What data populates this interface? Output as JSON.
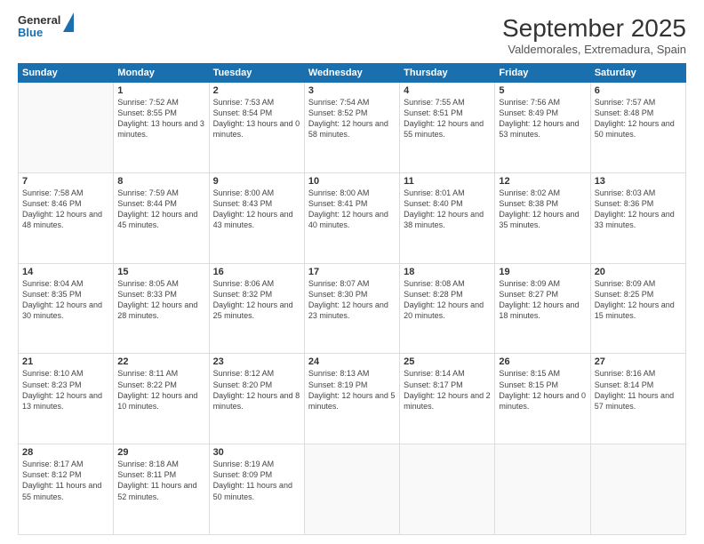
{
  "logo": {
    "line1": "General",
    "line2": "Blue"
  },
  "title": "September 2025",
  "subtitle": "Valdemorales, Extremadura, Spain",
  "days_of_week": [
    "Sunday",
    "Monday",
    "Tuesday",
    "Wednesday",
    "Thursday",
    "Friday",
    "Saturday"
  ],
  "weeks": [
    [
      {
        "day": "",
        "sunrise": "",
        "sunset": "",
        "daylight": ""
      },
      {
        "day": "1",
        "sunrise": "Sunrise: 7:52 AM",
        "sunset": "Sunset: 8:55 PM",
        "daylight": "Daylight: 13 hours and 3 minutes."
      },
      {
        "day": "2",
        "sunrise": "Sunrise: 7:53 AM",
        "sunset": "Sunset: 8:54 PM",
        "daylight": "Daylight: 13 hours and 0 minutes."
      },
      {
        "day": "3",
        "sunrise": "Sunrise: 7:54 AM",
        "sunset": "Sunset: 8:52 PM",
        "daylight": "Daylight: 12 hours and 58 minutes."
      },
      {
        "day": "4",
        "sunrise": "Sunrise: 7:55 AM",
        "sunset": "Sunset: 8:51 PM",
        "daylight": "Daylight: 12 hours and 55 minutes."
      },
      {
        "day": "5",
        "sunrise": "Sunrise: 7:56 AM",
        "sunset": "Sunset: 8:49 PM",
        "daylight": "Daylight: 12 hours and 53 minutes."
      },
      {
        "day": "6",
        "sunrise": "Sunrise: 7:57 AM",
        "sunset": "Sunset: 8:48 PM",
        "daylight": "Daylight: 12 hours and 50 minutes."
      }
    ],
    [
      {
        "day": "7",
        "sunrise": "Sunrise: 7:58 AM",
        "sunset": "Sunset: 8:46 PM",
        "daylight": "Daylight: 12 hours and 48 minutes."
      },
      {
        "day": "8",
        "sunrise": "Sunrise: 7:59 AM",
        "sunset": "Sunset: 8:44 PM",
        "daylight": "Daylight: 12 hours and 45 minutes."
      },
      {
        "day": "9",
        "sunrise": "Sunrise: 8:00 AM",
        "sunset": "Sunset: 8:43 PM",
        "daylight": "Daylight: 12 hours and 43 minutes."
      },
      {
        "day": "10",
        "sunrise": "Sunrise: 8:00 AM",
        "sunset": "Sunset: 8:41 PM",
        "daylight": "Daylight: 12 hours and 40 minutes."
      },
      {
        "day": "11",
        "sunrise": "Sunrise: 8:01 AM",
        "sunset": "Sunset: 8:40 PM",
        "daylight": "Daylight: 12 hours and 38 minutes."
      },
      {
        "day": "12",
        "sunrise": "Sunrise: 8:02 AM",
        "sunset": "Sunset: 8:38 PM",
        "daylight": "Daylight: 12 hours and 35 minutes."
      },
      {
        "day": "13",
        "sunrise": "Sunrise: 8:03 AM",
        "sunset": "Sunset: 8:36 PM",
        "daylight": "Daylight: 12 hours and 33 minutes."
      }
    ],
    [
      {
        "day": "14",
        "sunrise": "Sunrise: 8:04 AM",
        "sunset": "Sunset: 8:35 PM",
        "daylight": "Daylight: 12 hours and 30 minutes."
      },
      {
        "day": "15",
        "sunrise": "Sunrise: 8:05 AM",
        "sunset": "Sunset: 8:33 PM",
        "daylight": "Daylight: 12 hours and 28 minutes."
      },
      {
        "day": "16",
        "sunrise": "Sunrise: 8:06 AM",
        "sunset": "Sunset: 8:32 PM",
        "daylight": "Daylight: 12 hours and 25 minutes."
      },
      {
        "day": "17",
        "sunrise": "Sunrise: 8:07 AM",
        "sunset": "Sunset: 8:30 PM",
        "daylight": "Daylight: 12 hours and 23 minutes."
      },
      {
        "day": "18",
        "sunrise": "Sunrise: 8:08 AM",
        "sunset": "Sunset: 8:28 PM",
        "daylight": "Daylight: 12 hours and 20 minutes."
      },
      {
        "day": "19",
        "sunrise": "Sunrise: 8:09 AM",
        "sunset": "Sunset: 8:27 PM",
        "daylight": "Daylight: 12 hours and 18 minutes."
      },
      {
        "day": "20",
        "sunrise": "Sunrise: 8:09 AM",
        "sunset": "Sunset: 8:25 PM",
        "daylight": "Daylight: 12 hours and 15 minutes."
      }
    ],
    [
      {
        "day": "21",
        "sunrise": "Sunrise: 8:10 AM",
        "sunset": "Sunset: 8:23 PM",
        "daylight": "Daylight: 12 hours and 13 minutes."
      },
      {
        "day": "22",
        "sunrise": "Sunrise: 8:11 AM",
        "sunset": "Sunset: 8:22 PM",
        "daylight": "Daylight: 12 hours and 10 minutes."
      },
      {
        "day": "23",
        "sunrise": "Sunrise: 8:12 AM",
        "sunset": "Sunset: 8:20 PM",
        "daylight": "Daylight: 12 hours and 8 minutes."
      },
      {
        "day": "24",
        "sunrise": "Sunrise: 8:13 AM",
        "sunset": "Sunset: 8:19 PM",
        "daylight": "Daylight: 12 hours and 5 minutes."
      },
      {
        "day": "25",
        "sunrise": "Sunrise: 8:14 AM",
        "sunset": "Sunset: 8:17 PM",
        "daylight": "Daylight: 12 hours and 2 minutes."
      },
      {
        "day": "26",
        "sunrise": "Sunrise: 8:15 AM",
        "sunset": "Sunset: 8:15 PM",
        "daylight": "Daylight: 12 hours and 0 minutes."
      },
      {
        "day": "27",
        "sunrise": "Sunrise: 8:16 AM",
        "sunset": "Sunset: 8:14 PM",
        "daylight": "Daylight: 11 hours and 57 minutes."
      }
    ],
    [
      {
        "day": "28",
        "sunrise": "Sunrise: 8:17 AM",
        "sunset": "Sunset: 8:12 PM",
        "daylight": "Daylight: 11 hours and 55 minutes."
      },
      {
        "day": "29",
        "sunrise": "Sunrise: 8:18 AM",
        "sunset": "Sunset: 8:11 PM",
        "daylight": "Daylight: 11 hours and 52 minutes."
      },
      {
        "day": "30",
        "sunrise": "Sunrise: 8:19 AM",
        "sunset": "Sunset: 8:09 PM",
        "daylight": "Daylight: 11 hours and 50 minutes."
      },
      {
        "day": "",
        "sunrise": "",
        "sunset": "",
        "daylight": ""
      },
      {
        "day": "",
        "sunrise": "",
        "sunset": "",
        "daylight": ""
      },
      {
        "day": "",
        "sunrise": "",
        "sunset": "",
        "daylight": ""
      },
      {
        "day": "",
        "sunrise": "",
        "sunset": "",
        "daylight": ""
      }
    ]
  ]
}
